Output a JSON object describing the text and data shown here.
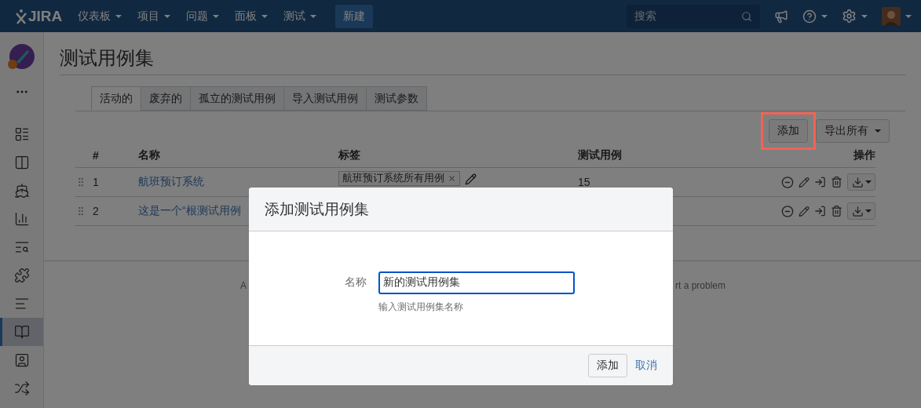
{
  "header": {
    "logo": "JIRA",
    "nav": [
      {
        "label": "仪表板"
      },
      {
        "label": "项目"
      },
      {
        "label": "问题"
      },
      {
        "label": "面板"
      },
      {
        "label": "测试"
      }
    ],
    "create": "新建",
    "search": {
      "placeholder": "搜索"
    }
  },
  "sidebar": {
    "items": [
      {
        "kind": "roadmap",
        "selected": false
      },
      {
        "kind": "board",
        "selected": false
      },
      {
        "kind": "releases",
        "selected": false
      },
      {
        "kind": "reports",
        "selected": false
      },
      {
        "kind": "search",
        "selected": false
      },
      {
        "kind": "components",
        "selected": false
      },
      {
        "kind": "list",
        "selected": false
      },
      {
        "kind": "tests",
        "selected": true
      },
      {
        "kind": "contact",
        "selected": false
      },
      {
        "kind": "shuffle",
        "selected": false
      }
    ]
  },
  "title": "测试用例集",
  "tabs": [
    {
      "label": "活动的",
      "selected": true
    },
    {
      "label": "废弃的",
      "selected": false
    },
    {
      "label": "孤立的测试用例",
      "selected": false
    },
    {
      "label": "导入测试用例",
      "selected": false
    },
    {
      "label": "测试参数",
      "selected": false
    }
  ],
  "toolbar": {
    "add": {
      "label": "添加",
      "highlighted": true
    },
    "export": "导出所有"
  },
  "table": {
    "columns": [
      "#",
      "名称",
      "标签",
      "测试用例",
      "操作"
    ],
    "rows": [
      {
        "number": "1",
        "name": "航班预订系统",
        "tag": "航班预订系统所有用例",
        "count": "15"
      },
      {
        "number": "2",
        "name": "这是一个“根测试用例"
      }
    ]
  },
  "footer": {
    "left": "A",
    "right": "rt a problem"
  },
  "dialog": {
    "title": "添加测试用例集",
    "field_label": "名称",
    "field_value": "新的测试用例集",
    "hint": "输入测试用例集名称",
    "submit": "添加",
    "cancel": "取消"
  }
}
